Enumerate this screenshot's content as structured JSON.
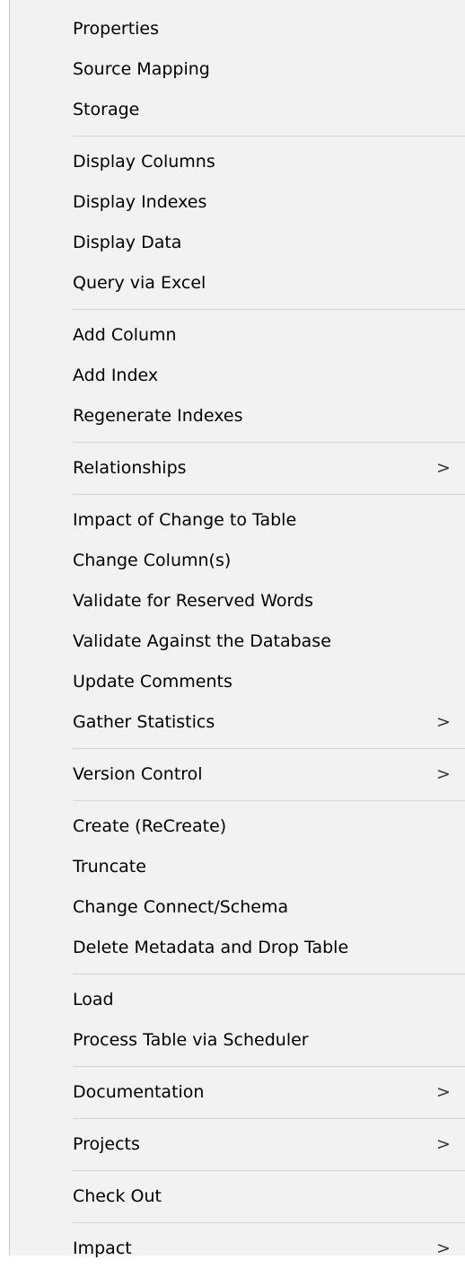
{
  "menu": {
    "groups": [
      {
        "items": [
          {
            "label": "Properties"
          },
          {
            "label": "Source Mapping"
          },
          {
            "label": "Storage"
          }
        ]
      },
      {
        "items": [
          {
            "label": "Display Columns"
          },
          {
            "label": "Display Indexes"
          },
          {
            "label": "Display Data"
          },
          {
            "label": "Query via Excel"
          }
        ]
      },
      {
        "items": [
          {
            "label": "Add Column"
          },
          {
            "label": "Add Index"
          },
          {
            "label": "Regenerate Indexes"
          }
        ]
      },
      {
        "items": [
          {
            "label": "Relationships",
            "submenu": ">"
          }
        ]
      },
      {
        "items": [
          {
            "label": "Impact of Change to Table"
          },
          {
            "label": "Change Column(s)"
          },
          {
            "label": "Validate for Reserved Words"
          },
          {
            "label": "Validate Against the Database"
          },
          {
            "label": "Update Comments"
          },
          {
            "label": "Gather Statistics",
            "submenu": ">"
          }
        ]
      },
      {
        "items": [
          {
            "label": "Version Control",
            "submenu": ">"
          }
        ]
      },
      {
        "items": [
          {
            "label": "Create (ReCreate)"
          },
          {
            "label": "Truncate"
          },
          {
            "label": "Change Connect/Schema"
          },
          {
            "label": "Delete Metadata and Drop Table"
          }
        ]
      },
      {
        "items": [
          {
            "label": "Load"
          },
          {
            "label": "Process Table via Scheduler"
          }
        ]
      },
      {
        "items": [
          {
            "label": "Documentation",
            "submenu": ">"
          }
        ]
      },
      {
        "items": [
          {
            "label": "Projects",
            "submenu": ">"
          }
        ]
      },
      {
        "items": [
          {
            "label": "Check Out"
          }
        ]
      },
      {
        "items": [
          {
            "label": "Impact",
            "submenu": ">"
          }
        ]
      }
    ]
  }
}
